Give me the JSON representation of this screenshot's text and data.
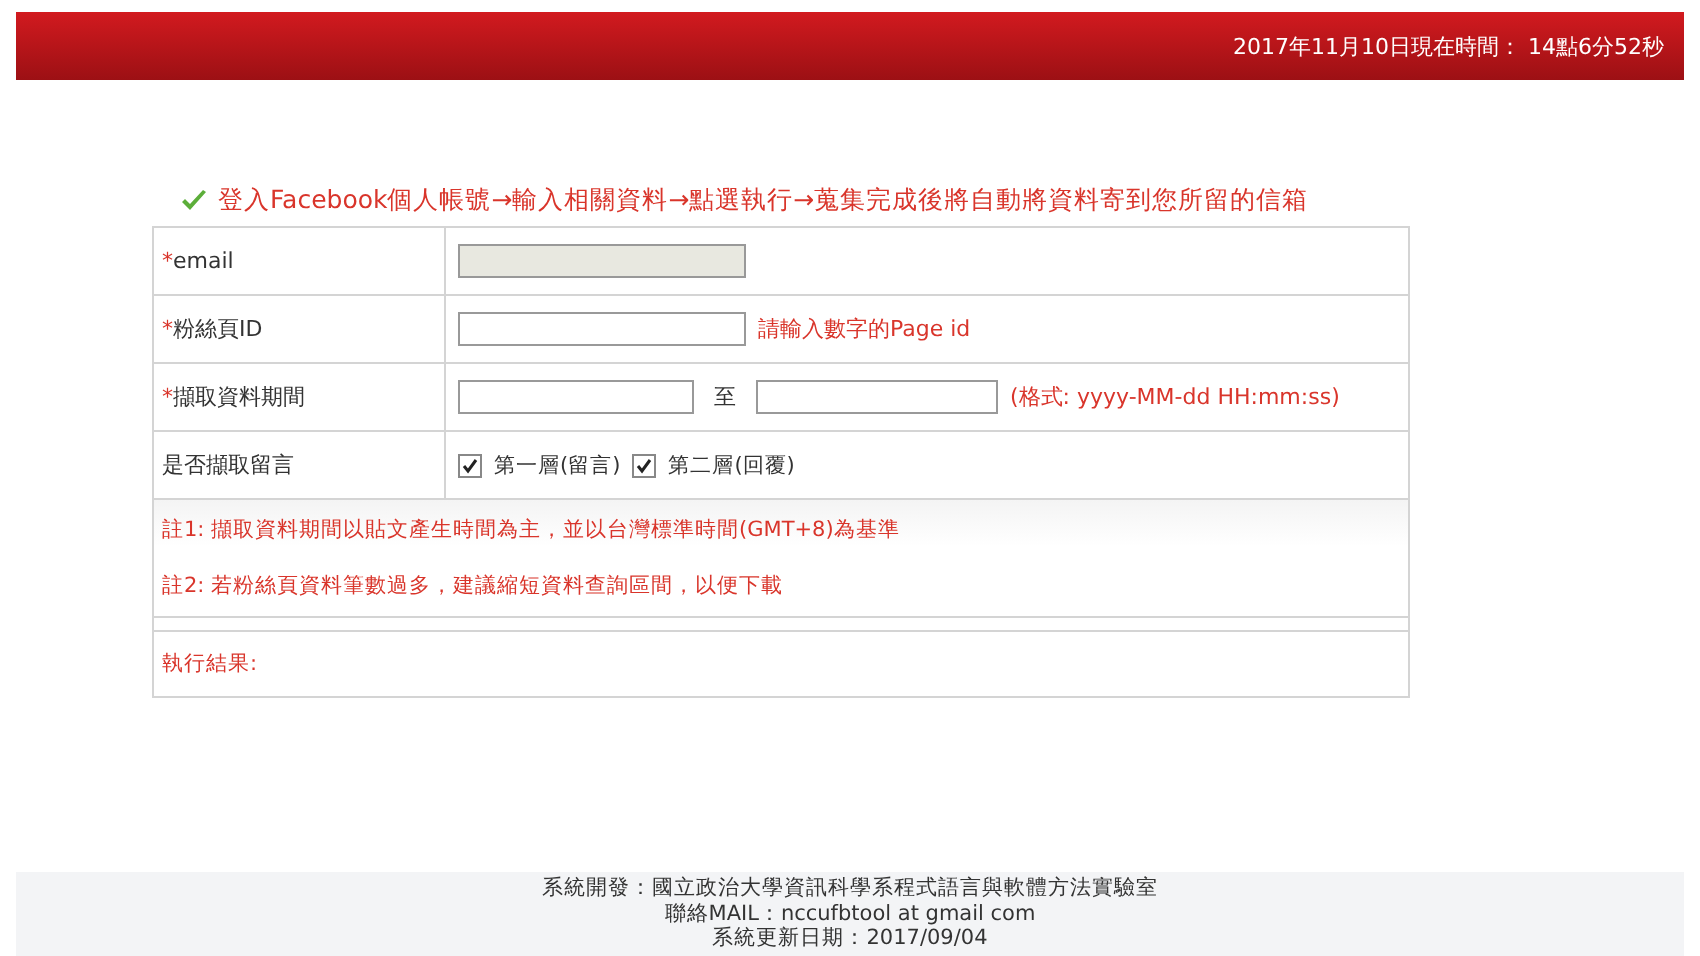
{
  "header": {
    "clock": "2017年11月10日現在時間： 14點6分52秒"
  },
  "instruction": "登入Facebook個人帳號→輸入相關資料→點選執行→蒐集完成後將自動將資料寄到您所留的信箱",
  "form": {
    "rows": [
      {
        "kind": "field",
        "marker": "*",
        "label": "email",
        "disabled": true
      },
      {
        "kind": "field",
        "marker": "*",
        "label": "粉絲頁ID",
        "disabled": false,
        "hint": "請輸入數字的Page id"
      },
      {
        "kind": "range",
        "marker": "*",
        "label": "擷取資料期間",
        "separator": "至",
        "hint": "(格式: yyyy-MM-dd HH:mm:ss)"
      },
      {
        "kind": "checks",
        "label": "是否擷取留言",
        "options": [
          {
            "label": "第一層(留言)",
            "checked": true
          },
          {
            "label": "第二層(回覆)",
            "checked": true
          }
        ]
      }
    ],
    "notes": [
      "註1: 擷取資料期間以貼文產生時間為主，並以台灣標準時間(GMT+8)為基準",
      "註2: 若粉絲頁資料筆數過多，建議縮短資料查詢區間，以便下載"
    ],
    "result_label": "執行結果:"
  },
  "footer": [
    "系統開發：國立政治大學資訊科學系程式語言與軟體方法實驗室",
    "聯絡MAIL：nccufbtool at gmail com",
    "系統更新日期：2017/09/04"
  ]
}
